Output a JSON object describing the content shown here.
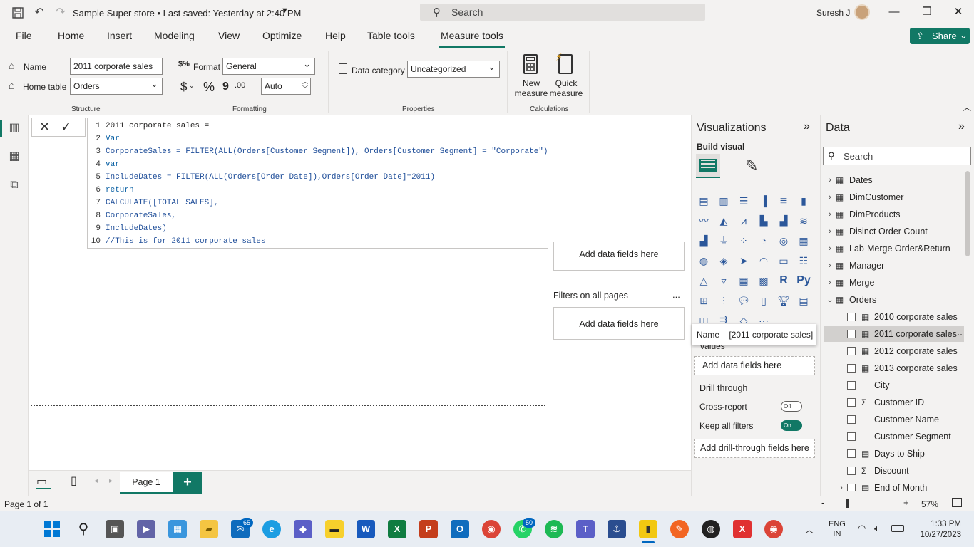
{
  "titlebar": {
    "doc_title": "Sample Super store • Last saved: Yesterday at 2:40 PM",
    "search_placeholder": "Search",
    "user_name": "Suresh J"
  },
  "menu": {
    "items": [
      "File",
      "Home",
      "Insert",
      "Modeling",
      "View",
      "Optimize",
      "Help",
      "Table tools",
      "Measure tools"
    ],
    "active": "Measure tools",
    "share_label": "Share"
  },
  "ribbon": {
    "name_label": "Name",
    "name_value": "2011 corporate sales",
    "home_table_label": "Home table",
    "home_table_value": "Orders",
    "structure_group": "Structure",
    "format_label": "Format",
    "format_value": "General",
    "currency_symbol": "$",
    "percent_symbol": "%",
    "comma_symbol": "9",
    "decimal_symbol": ".00",
    "auto_value": "Auto",
    "formatting_group": "Formatting",
    "data_category_label": "Data category",
    "data_category_value": "Uncategorized",
    "properties_group": "Properties",
    "new_measure_line1": "New",
    "new_measure_line2": "measure",
    "quick_measure_line1": "Quick",
    "quick_measure_line2": "measure",
    "calculations_group": "Calculations"
  },
  "editor": {
    "lines": [
      {
        "num": "1",
        "text": "2011 corporate sales ="
      },
      {
        "num": "2",
        "text": "Var"
      },
      {
        "num": "3",
        "text": "CorporateSales = FILTER(ALL(Orders[Customer Segment]), Orders[Customer Segment] = \"Corporate\")"
      },
      {
        "num": "4",
        "text": "var"
      },
      {
        "num": "5",
        "text": "IncludeDates = FILTER(ALL(Orders[Order Date]),Orders[Order Date]=2011)"
      },
      {
        "num": "6",
        "text": "return"
      },
      {
        "num": "7",
        "text": "CALCULATE([TOTAL SALES],"
      },
      {
        "num": "8",
        "text": "CorporateSales,"
      },
      {
        "num": "9",
        "text": "IncludeDates)"
      },
      {
        "num": "10",
        "text": "//This is for 2011 corporate sales"
      }
    ]
  },
  "filters": {
    "add_fields_1": "Add data fields here",
    "all_pages_label": "Filters on all pages",
    "all_pages_more": "...",
    "add_fields_2": "Add data fields here"
  },
  "visualizations": {
    "title": "Visualizations",
    "build_visual": "Build visual",
    "tooltip_name_label": "Name",
    "tooltip_name_value": "[2011 corporate sales]",
    "values_label": "Values",
    "add_data_fields": "Add data fields here",
    "drill_through": "Drill through",
    "cross_report": "Cross-report",
    "cross_report_state": "Off",
    "keep_all_filters": "Keep all filters",
    "keep_all_filters_state": "On",
    "add_drill_fields": "Add drill-through fields here",
    "more": "...",
    "icons": [
      "stacked-bar",
      "stacked-column",
      "clustered-bar",
      "clustered-column",
      "100-bar",
      "100-column",
      "line",
      "area",
      "stacked-area",
      "line-column",
      "line-clustered",
      "ribbon",
      "waterfall",
      "funnel",
      "scatter",
      "pie",
      "donut",
      "treemap",
      "map",
      "filled-map",
      "azure-map",
      "gauge",
      "card",
      "multi-row-card",
      "kpi",
      "slicer",
      "table",
      "matrix",
      "r-visual",
      "python-visual",
      "key-influencers",
      "decomp-tree",
      "qa",
      "narrative",
      "goals",
      "paginated",
      "power-apps",
      "power-automate",
      "diamond",
      "more-visuals"
    ]
  },
  "data": {
    "title": "Data",
    "search_placeholder": "Search",
    "tables": [
      "Dates",
      "DimCustomer",
      "DimProducts",
      "Disinct Order Count",
      "Lab-Merge Order&Return",
      "Manager",
      "Merge",
      "Orders"
    ],
    "fields": [
      {
        "label": "2010 corporate sales",
        "icon": "measure"
      },
      {
        "label": "2011 corporate sales",
        "icon": "measure"
      },
      {
        "label": "2012 corporate sales",
        "icon": "measure"
      },
      {
        "label": "2013 corporate sales",
        "icon": "measure"
      },
      {
        "label": "City",
        "icon": ""
      },
      {
        "label": "Customer ID",
        "icon": "sigma"
      },
      {
        "label": "Customer Name",
        "icon": ""
      },
      {
        "label": "Customer Segment",
        "icon": ""
      },
      {
        "label": "Days to Ship",
        "icon": "calc-column"
      },
      {
        "label": "Discount",
        "icon": "sigma"
      },
      {
        "label": "End of Month",
        "icon": "calc-column"
      }
    ],
    "row_more": "···"
  },
  "pages": {
    "page1": "Page 1"
  },
  "status": {
    "page_info": "Page 1 of 1",
    "zoom": "57%",
    "zoom_minus": "-",
    "zoom_plus": "+"
  },
  "taskbar": {
    "outlook_badge": "65",
    "whatsapp_badge": "50",
    "lang_line1": "ENG",
    "lang_line2": "IN",
    "time": "1:33 PM",
    "date": "10/27/2023"
  },
  "colors": {
    "accent": "#117865",
    "code": "#1f4e99"
  }
}
